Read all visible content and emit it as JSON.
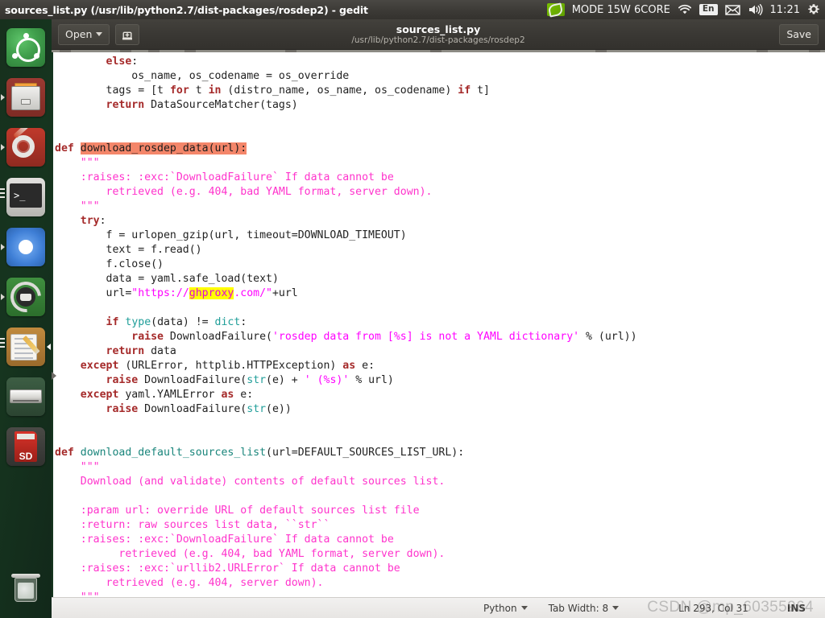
{
  "top_panel": {
    "window_title": "sources_list.py (/usr/lib/python2.7/dist-packages/rosdep2) - gedit",
    "tray": {
      "nvidia_icon": "nvidia-logo-icon",
      "power_mode": "MODE 15W 6CORE",
      "wifi_icon": "wifi-icon",
      "language": "En",
      "mail_icon": "mail-icon",
      "volume_icon": "volume-icon",
      "clock": "11:21",
      "session_icon": "session-gear-icon"
    }
  },
  "launcher": {
    "items": [
      {
        "name": "ubuntu-software",
        "label": "Ubuntu Software"
      },
      {
        "name": "files",
        "label": "Files"
      },
      {
        "name": "system-settings",
        "label": "System Settings"
      },
      {
        "name": "terminal",
        "label": "Terminal"
      },
      {
        "name": "chromium",
        "label": "Chromium Web Browser"
      },
      {
        "name": "android-tool",
        "label": "Android Tool"
      },
      {
        "name": "gedit",
        "label": "gedit Text Editor"
      },
      {
        "name": "disk-drive",
        "label": "Disk Drive"
      },
      {
        "name": "sd-card",
        "label": "SD Card"
      }
    ],
    "trash": {
      "name": "trash",
      "label": "Trash"
    }
  },
  "toolbar": {
    "open_label": "Open",
    "new_document_icon": "new-document-icon",
    "doc_title": "sources_list.py",
    "doc_subtitle": "/usr/lib/python2.7/dist-packages/rosdep2",
    "save_label": "Save"
  },
  "statusbar": {
    "language": "Python",
    "tab_width": "Tab Width: 8",
    "position": "Ln 293, Col 31",
    "insert_mode": "INS"
  },
  "watermark": "CSDN @mp_60355964",
  "editor": {
    "selection_text": "download_rosdep_data(url):",
    "search_match": "ghproxy",
    "lines": [
      {
        "indent": 8,
        "parts": [
          {
            "t": "else",
            "c": "kw"
          },
          {
            "t": ":",
            "c": "pl"
          }
        ]
      },
      {
        "indent": 12,
        "parts": [
          {
            "t": "os_name, os_codename = os_override",
            "c": "pl"
          }
        ]
      },
      {
        "indent": 8,
        "parts": [
          {
            "t": "tags = [t ",
            "c": "pl"
          },
          {
            "t": "for",
            "c": "kw"
          },
          {
            "t": " t ",
            "c": "pl"
          },
          {
            "t": "in",
            "c": "kw"
          },
          {
            "t": " (distro_name, os_name, os_codename) ",
            "c": "pl"
          },
          {
            "t": "if",
            "c": "kw"
          },
          {
            "t": " t]",
            "c": "pl"
          }
        ]
      },
      {
        "indent": 8,
        "parts": [
          {
            "t": "return",
            "c": "kw"
          },
          {
            "t": " DataSourceMatcher(tags)",
            "c": "pl"
          }
        ]
      },
      {
        "indent": 0,
        "parts": []
      },
      {
        "indent": 0,
        "parts": []
      },
      {
        "indent": 0,
        "parts": [
          {
            "t": "def",
            "c": "kw"
          },
          {
            "t": " ",
            "c": "pl"
          },
          {
            "t": "download_rosdep_data(url):",
            "c": "sel"
          }
        ]
      },
      {
        "indent": 4,
        "parts": [
          {
            "t": "\"\"\"",
            "c": "doc"
          }
        ]
      },
      {
        "indent": 4,
        "parts": [
          {
            "t": ":raises: :exc:`DownloadFailure` If data cannot be",
            "c": "doc"
          }
        ]
      },
      {
        "indent": 8,
        "parts": [
          {
            "t": "retrieved (e.g. 404, bad YAML format, server down).",
            "c": "doc"
          }
        ]
      },
      {
        "indent": 4,
        "parts": [
          {
            "t": "\"\"\"",
            "c": "doc"
          }
        ]
      },
      {
        "indent": 4,
        "parts": [
          {
            "t": "try",
            "c": "kw"
          },
          {
            "t": ":",
            "c": "pl"
          }
        ]
      },
      {
        "indent": 8,
        "parts": [
          {
            "t": "f = urlopen_gzip(url, timeout=DOWNLOAD_TIMEOUT)",
            "c": "pl"
          }
        ]
      },
      {
        "indent": 8,
        "parts": [
          {
            "t": "text = f.read()",
            "c": "pl"
          }
        ]
      },
      {
        "indent": 8,
        "parts": [
          {
            "t": "f.close()",
            "c": "pl"
          }
        ]
      },
      {
        "indent": 8,
        "parts": [
          {
            "t": "data = yaml.safe_load(text)",
            "c": "pl"
          }
        ]
      },
      {
        "indent": 8,
        "parts": [
          {
            "t": "url=",
            "c": "pl"
          },
          {
            "t": "\"https://",
            "c": "str"
          },
          {
            "t": "ghproxy",
            "c": "hit"
          },
          {
            "t": ".com/\"",
            "c": "str"
          },
          {
            "t": "+url",
            "c": "pl"
          }
        ]
      },
      {
        "indent": 0,
        "parts": []
      },
      {
        "indent": 8,
        "parts": [
          {
            "t": "if",
            "c": "kw"
          },
          {
            "t": " ",
            "c": "pl"
          },
          {
            "t": "type",
            "c": "bi"
          },
          {
            "t": "(data) != ",
            "c": "pl"
          },
          {
            "t": "dict",
            "c": "bi"
          },
          {
            "t": ":",
            "c": "pl"
          }
        ]
      },
      {
        "indent": 12,
        "parts": [
          {
            "t": "raise",
            "c": "kw"
          },
          {
            "t": " DownloadFailure(",
            "c": "pl"
          },
          {
            "t": "'rosdep data from [%s] is not a YAML dictionary'",
            "c": "str"
          },
          {
            "t": " % (url))",
            "c": "pl"
          }
        ]
      },
      {
        "indent": 8,
        "parts": [
          {
            "t": "return",
            "c": "kw"
          },
          {
            "t": " data",
            "c": "pl"
          }
        ]
      },
      {
        "indent": 4,
        "parts": [
          {
            "t": "except",
            "c": "kw"
          },
          {
            "t": " (URLError, httplib.HTTPException) ",
            "c": "pl"
          },
          {
            "t": "as",
            "c": "kw"
          },
          {
            "t": " e:",
            "c": "pl"
          }
        ]
      },
      {
        "indent": 8,
        "parts": [
          {
            "t": "raise",
            "c": "kw"
          },
          {
            "t": " DownloadFailure(",
            "c": "pl"
          },
          {
            "t": "str",
            "c": "bi"
          },
          {
            "t": "(e) + ",
            "c": "pl"
          },
          {
            "t": "' (%s)'",
            "c": "str"
          },
          {
            "t": " % url)",
            "c": "pl"
          }
        ]
      },
      {
        "indent": 4,
        "parts": [
          {
            "t": "except",
            "c": "kw"
          },
          {
            "t": " yaml.YAMLError ",
            "c": "pl"
          },
          {
            "t": "as",
            "c": "kw"
          },
          {
            "t": " e:",
            "c": "pl"
          }
        ]
      },
      {
        "indent": 8,
        "parts": [
          {
            "t": "raise",
            "c": "kw"
          },
          {
            "t": " DownloadFailure(",
            "c": "pl"
          },
          {
            "t": "str",
            "c": "bi"
          },
          {
            "t": "(e))",
            "c": "pl"
          }
        ]
      },
      {
        "indent": 0,
        "parts": []
      },
      {
        "indent": 0,
        "parts": []
      },
      {
        "indent": 0,
        "parts": [
          {
            "t": "def",
            "c": "kw"
          },
          {
            "t": " ",
            "c": "pl"
          },
          {
            "t": "download_default_sources_list",
            "c": "fn"
          },
          {
            "t": "(url=DEFAULT_SOURCES_LIST_URL):",
            "c": "pl"
          }
        ]
      },
      {
        "indent": 4,
        "parts": [
          {
            "t": "\"\"\"",
            "c": "doc"
          }
        ]
      },
      {
        "indent": 4,
        "parts": [
          {
            "t": "Download (and validate) contents of default sources list.",
            "c": "doc"
          }
        ]
      },
      {
        "indent": 0,
        "parts": []
      },
      {
        "indent": 4,
        "parts": [
          {
            "t": ":param url: override URL of default sources list file",
            "c": "doc"
          }
        ]
      },
      {
        "indent": 4,
        "parts": [
          {
            "t": ":return: raw sources list data, ``str``",
            "c": "doc"
          }
        ]
      },
      {
        "indent": 4,
        "parts": [
          {
            "t": ":raises: :exc:`DownloadFailure` If data cannot be",
            "c": "doc"
          }
        ]
      },
      {
        "indent": 10,
        "parts": [
          {
            "t": "retrieved (e.g. 404, bad YAML format, server down).",
            "c": "doc"
          }
        ]
      },
      {
        "indent": 4,
        "parts": [
          {
            "t": ":raises: :exc:`urllib2.URLError` If data cannot be",
            "c": "doc"
          }
        ]
      },
      {
        "indent": 8,
        "parts": [
          {
            "t": "retrieved (e.g. 404, server down).",
            "c": "doc"
          }
        ]
      },
      {
        "indent": 4,
        "parts": [
          {
            "t": "\"\"\"",
            "c": "doc"
          }
        ]
      }
    ]
  },
  "colors": {
    "keyword": "#a52a2a",
    "function": "#19857b",
    "builtin": "#1f9e99",
    "string": "#ff00ff",
    "docstring": "#ff33cc",
    "selection_bg": "#f4866a",
    "search_bg": "#ffff00",
    "panel_bg": "#3a3834",
    "launcher_bg": "#16351f",
    "editor_bg": "#ffffff"
  }
}
